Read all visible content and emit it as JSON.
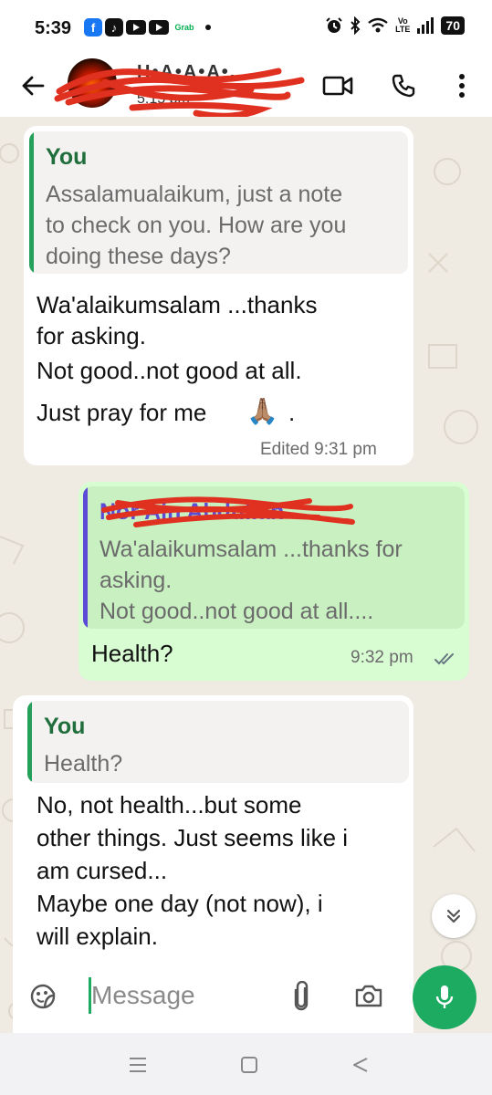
{
  "status_bar": {
    "time": "5:39",
    "grab_label": "Grab",
    "network_label": "Vo\nLTE",
    "battery": "70",
    "icons": [
      "facebook-icon",
      "tiktok-icon",
      "youtube-icon",
      "youtube-icon",
      "grab-icon",
      "alarm-icon",
      "bluetooth-icon",
      "wifi-icon",
      "signal-icon",
      "battery-icon"
    ]
  },
  "header": {
    "contact_name": "H•A•A•A•...",
    "last_seen": "5:15 pm"
  },
  "messages": [
    {
      "direction": "incoming",
      "quote_author": "You",
      "quote_lines": [
        "Assalamualaikum, just a note",
        "to check on you. How are you",
        "doing these days?"
      ],
      "text_lines": [
        "Wa'alaikumsalam ...thanks",
        "for asking.",
        "Not good..not good at all."
      ],
      "pray_line": "Just pray for me",
      "pray_emoji": "🙏🏽",
      "pray_tail": ".",
      "meta": "Edited 9:31 pm"
    },
    {
      "direction": "outgoing",
      "quote_author": "Nor Ain Abdullah",
      "quote_lines": [
        "Wa'alaikumsalam ...thanks for",
        "asking.",
        "Not good..not good at all...."
      ],
      "text": "Health?",
      "meta": "9:32 pm",
      "status": "read"
    },
    {
      "direction": "incoming",
      "quote_author": "You",
      "quote_lines": [
        "Health?"
      ],
      "text_lines": [
        "No, not health...but some",
        "other things. Just seems like i",
        "am cursed...",
        "Maybe one day (not now), i",
        "will explain."
      ]
    }
  ],
  "composer": {
    "placeholder": "Message"
  },
  "colors": {
    "accent_green": "#1daa61",
    "outgoing_bubble": "#d9fdd3",
    "chat_background": "#efeae2",
    "quote_you": "#25a05a",
    "quote_other": "#5b4bd6"
  }
}
